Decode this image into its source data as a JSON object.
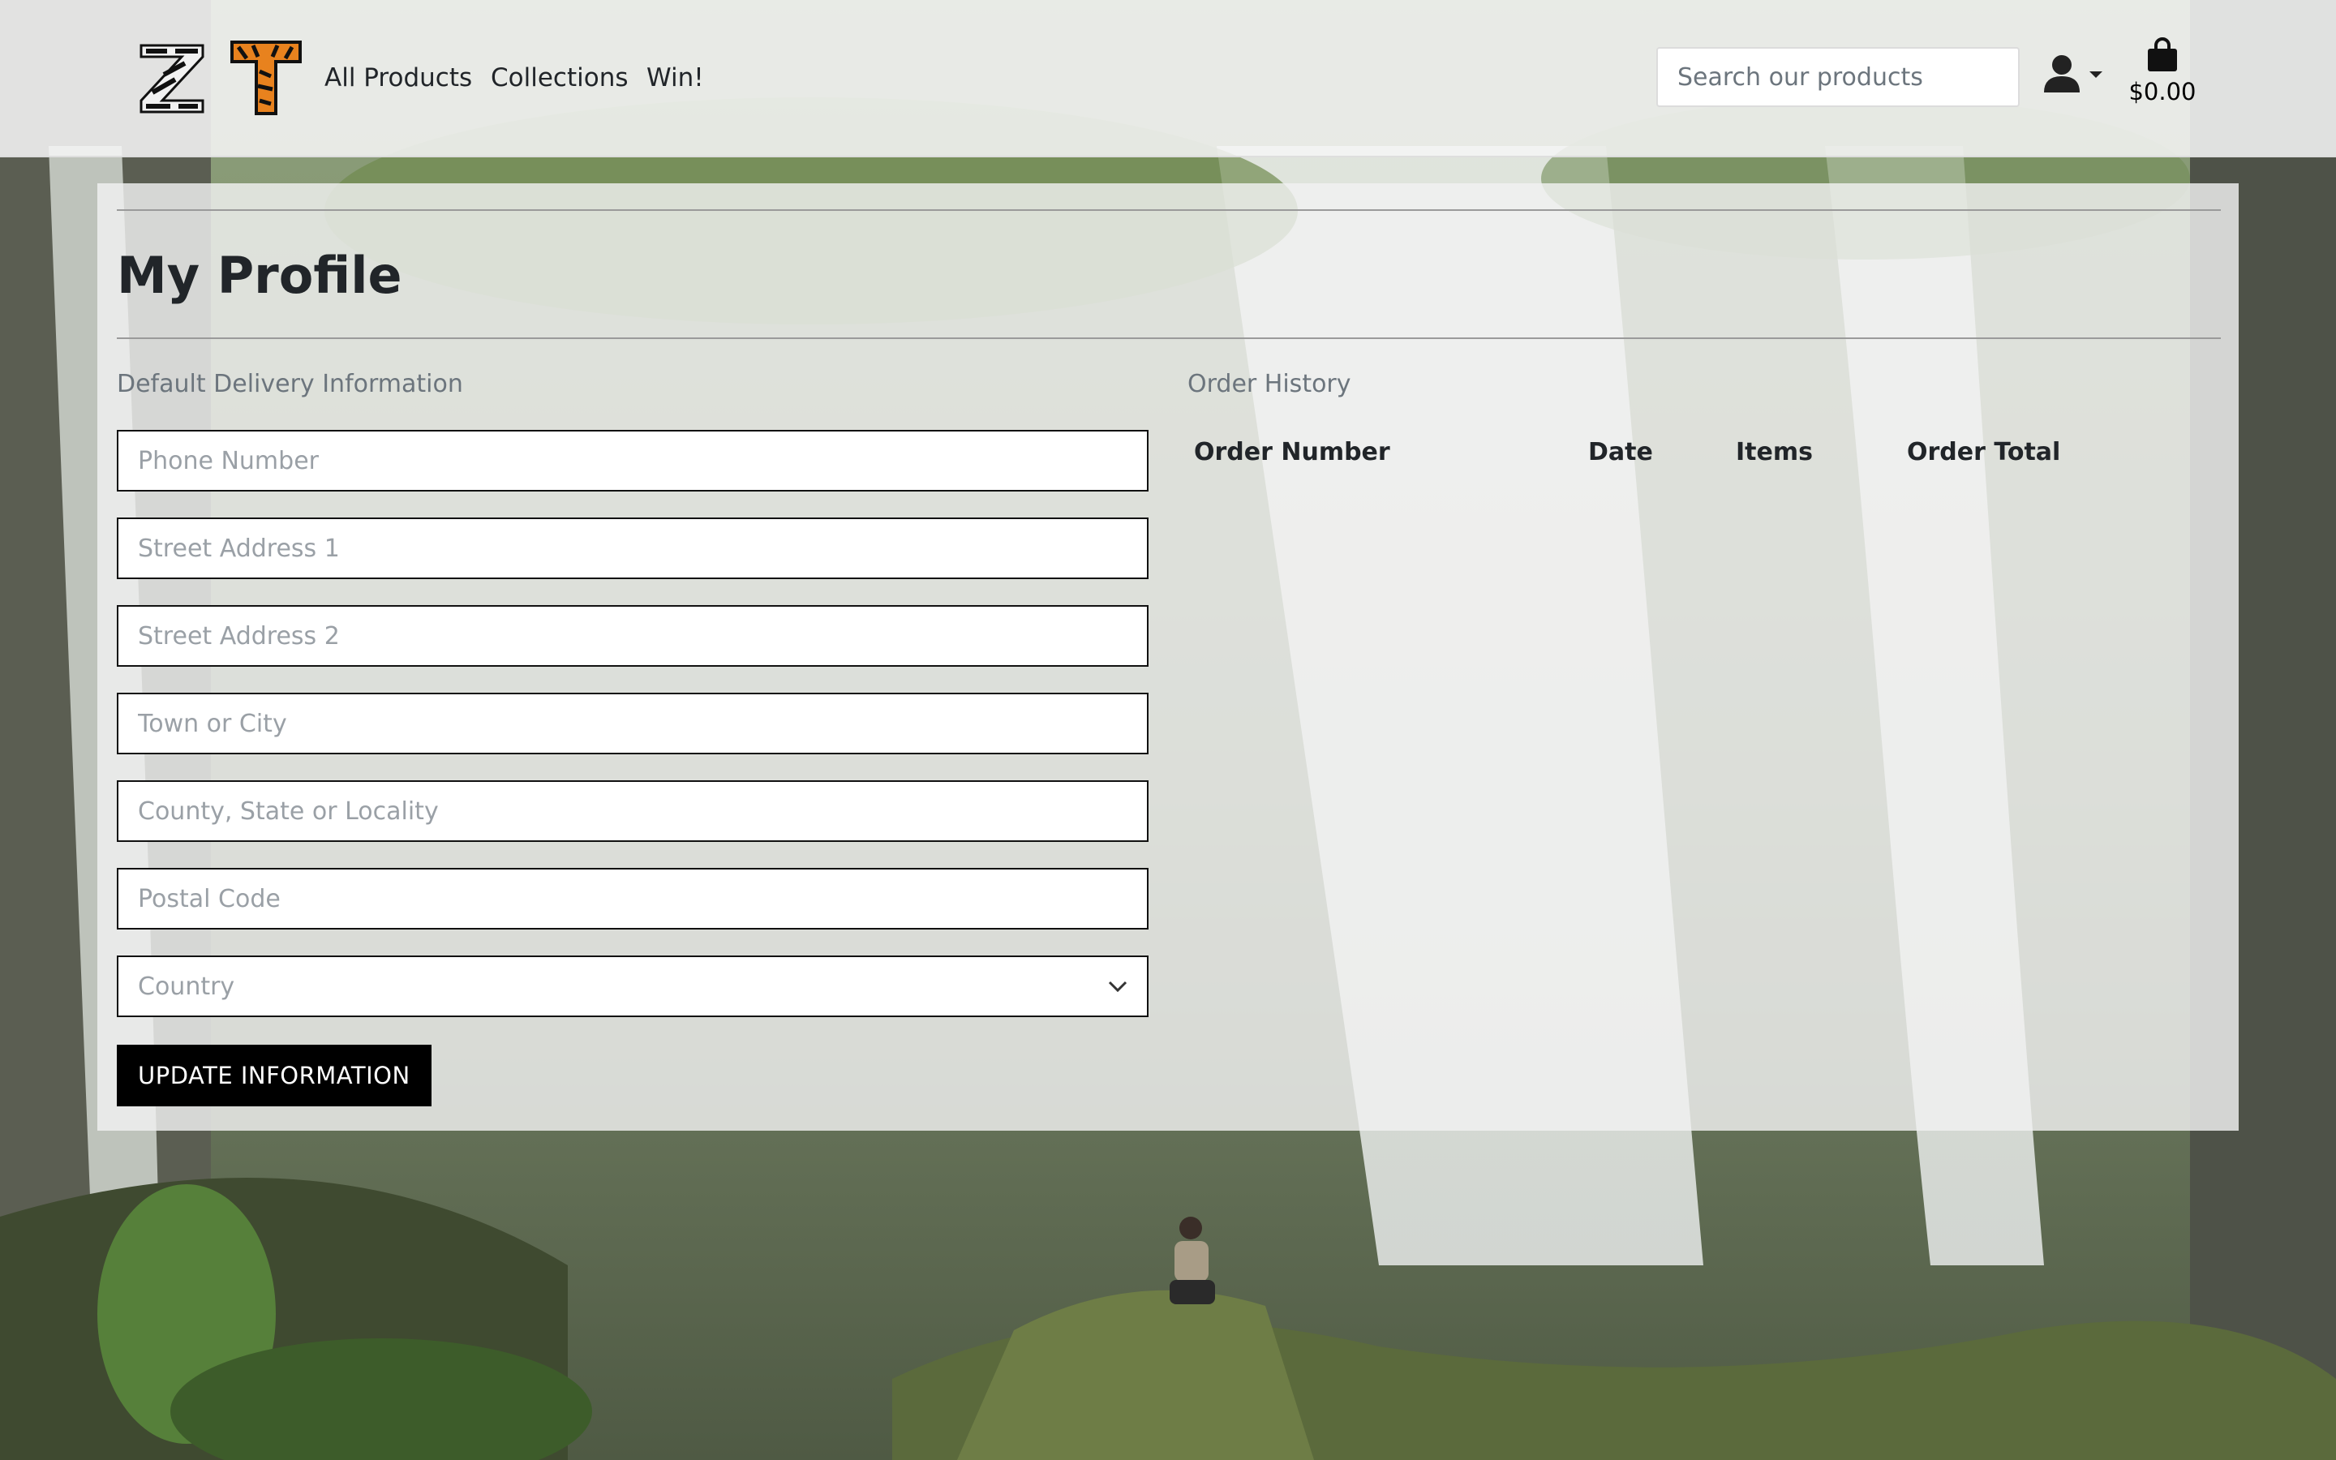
{
  "header": {
    "logo_z_alt": "Z",
    "logo_t_alt": "T",
    "nav": {
      "all_products": "All Products",
      "collections": "Collections",
      "win": "Win!"
    },
    "search": {
      "placeholder": "Search our products",
      "value": ""
    },
    "account_icon": "user-icon",
    "cart": {
      "icon": "shopping-bag-icon",
      "total": "$0.00"
    }
  },
  "main": {
    "title": "My Profile",
    "delivery": {
      "heading": "Default Delivery Information",
      "fields": {
        "phone": {
          "placeholder": "Phone Number",
          "value": ""
        },
        "street1": {
          "placeholder": "Street Address 1",
          "value": ""
        },
        "street2": {
          "placeholder": "Street Address 2",
          "value": ""
        },
        "town": {
          "placeholder": "Town or City",
          "value": ""
        },
        "county": {
          "placeholder": "County, State or Locality",
          "value": ""
        },
        "postcode": {
          "placeholder": "Postal Code",
          "value": ""
        }
      },
      "country": {
        "selected": "Country"
      },
      "update_label": "UPDATE INFORMATION"
    },
    "orders": {
      "heading": "Order History",
      "columns": [
        "Order Number",
        "Date",
        "Items",
        "Order Total"
      ],
      "rows": []
    }
  },
  "colors": {
    "button_bg": "#000000",
    "text": "#212529",
    "muted": "#6c757d",
    "logo_orange": "#e8821e"
  }
}
